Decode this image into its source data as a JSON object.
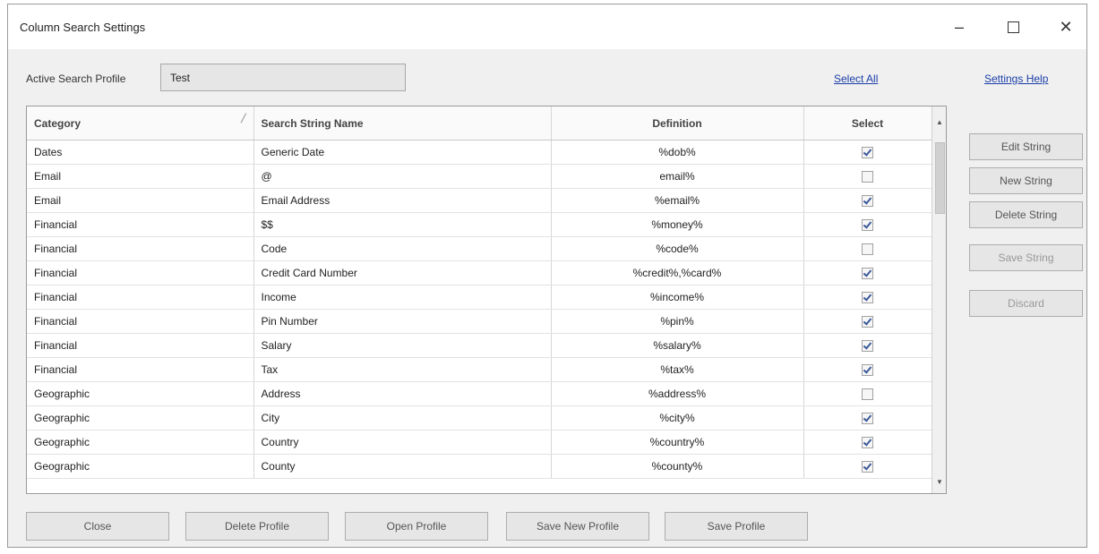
{
  "window": {
    "title": "Column Search Settings",
    "controls": {
      "minimize": "–",
      "maximize": "",
      "close": "✕"
    }
  },
  "profile": {
    "label": "Active Search Profile",
    "value": "Test"
  },
  "links": {
    "select_all": "Select All",
    "settings_help": "Settings Help"
  },
  "table": {
    "columns": [
      "Category",
      "Search String Name",
      "Definition",
      "Select"
    ],
    "rows": [
      {
        "category": "Dates",
        "name": "Generic Date",
        "definition": "%dob%",
        "selected": true
      },
      {
        "category": "Email",
        "name": "@",
        "definition": "email%",
        "selected": false
      },
      {
        "category": "Email",
        "name": "Email Address",
        "definition": "%email%",
        "selected": true
      },
      {
        "category": "Financial",
        "name": "$$",
        "definition": "%money%",
        "selected": true
      },
      {
        "category": "Financial",
        "name": "Code",
        "definition": "%code%",
        "selected": false
      },
      {
        "category": "Financial",
        "name": "Credit Card Number",
        "definition": "%credit%,%card%",
        "selected": true
      },
      {
        "category": "Financial",
        "name": "Income",
        "definition": "%income%",
        "selected": true
      },
      {
        "category": "Financial",
        "name": "Pin Number",
        "definition": "%pin%",
        "selected": true
      },
      {
        "category": "Financial",
        "name": "Salary",
        "definition": "%salary%",
        "selected": true
      },
      {
        "category": "Financial",
        "name": "Tax",
        "definition": "%tax%",
        "selected": true
      },
      {
        "category": "Geographic",
        "name": "Address",
        "definition": "%address%",
        "selected": false
      },
      {
        "category": "Geographic",
        "name": "City",
        "definition": "%city%",
        "selected": true
      },
      {
        "category": "Geographic",
        "name": "Country",
        "definition": "%country%",
        "selected": true
      },
      {
        "category": "Geographic",
        "name": "County",
        "definition": "%county%",
        "selected": true
      }
    ]
  },
  "side_buttons": {
    "edit": "Edit String",
    "new": "New String",
    "delete": "Delete String",
    "save": "Save String",
    "discard": "Discard"
  },
  "bottom_buttons": {
    "close": "Close",
    "delete_profile": "Delete Profile",
    "open_profile": "Open Profile",
    "save_new_profile": "Save New Profile",
    "save_profile": "Save Profile"
  }
}
